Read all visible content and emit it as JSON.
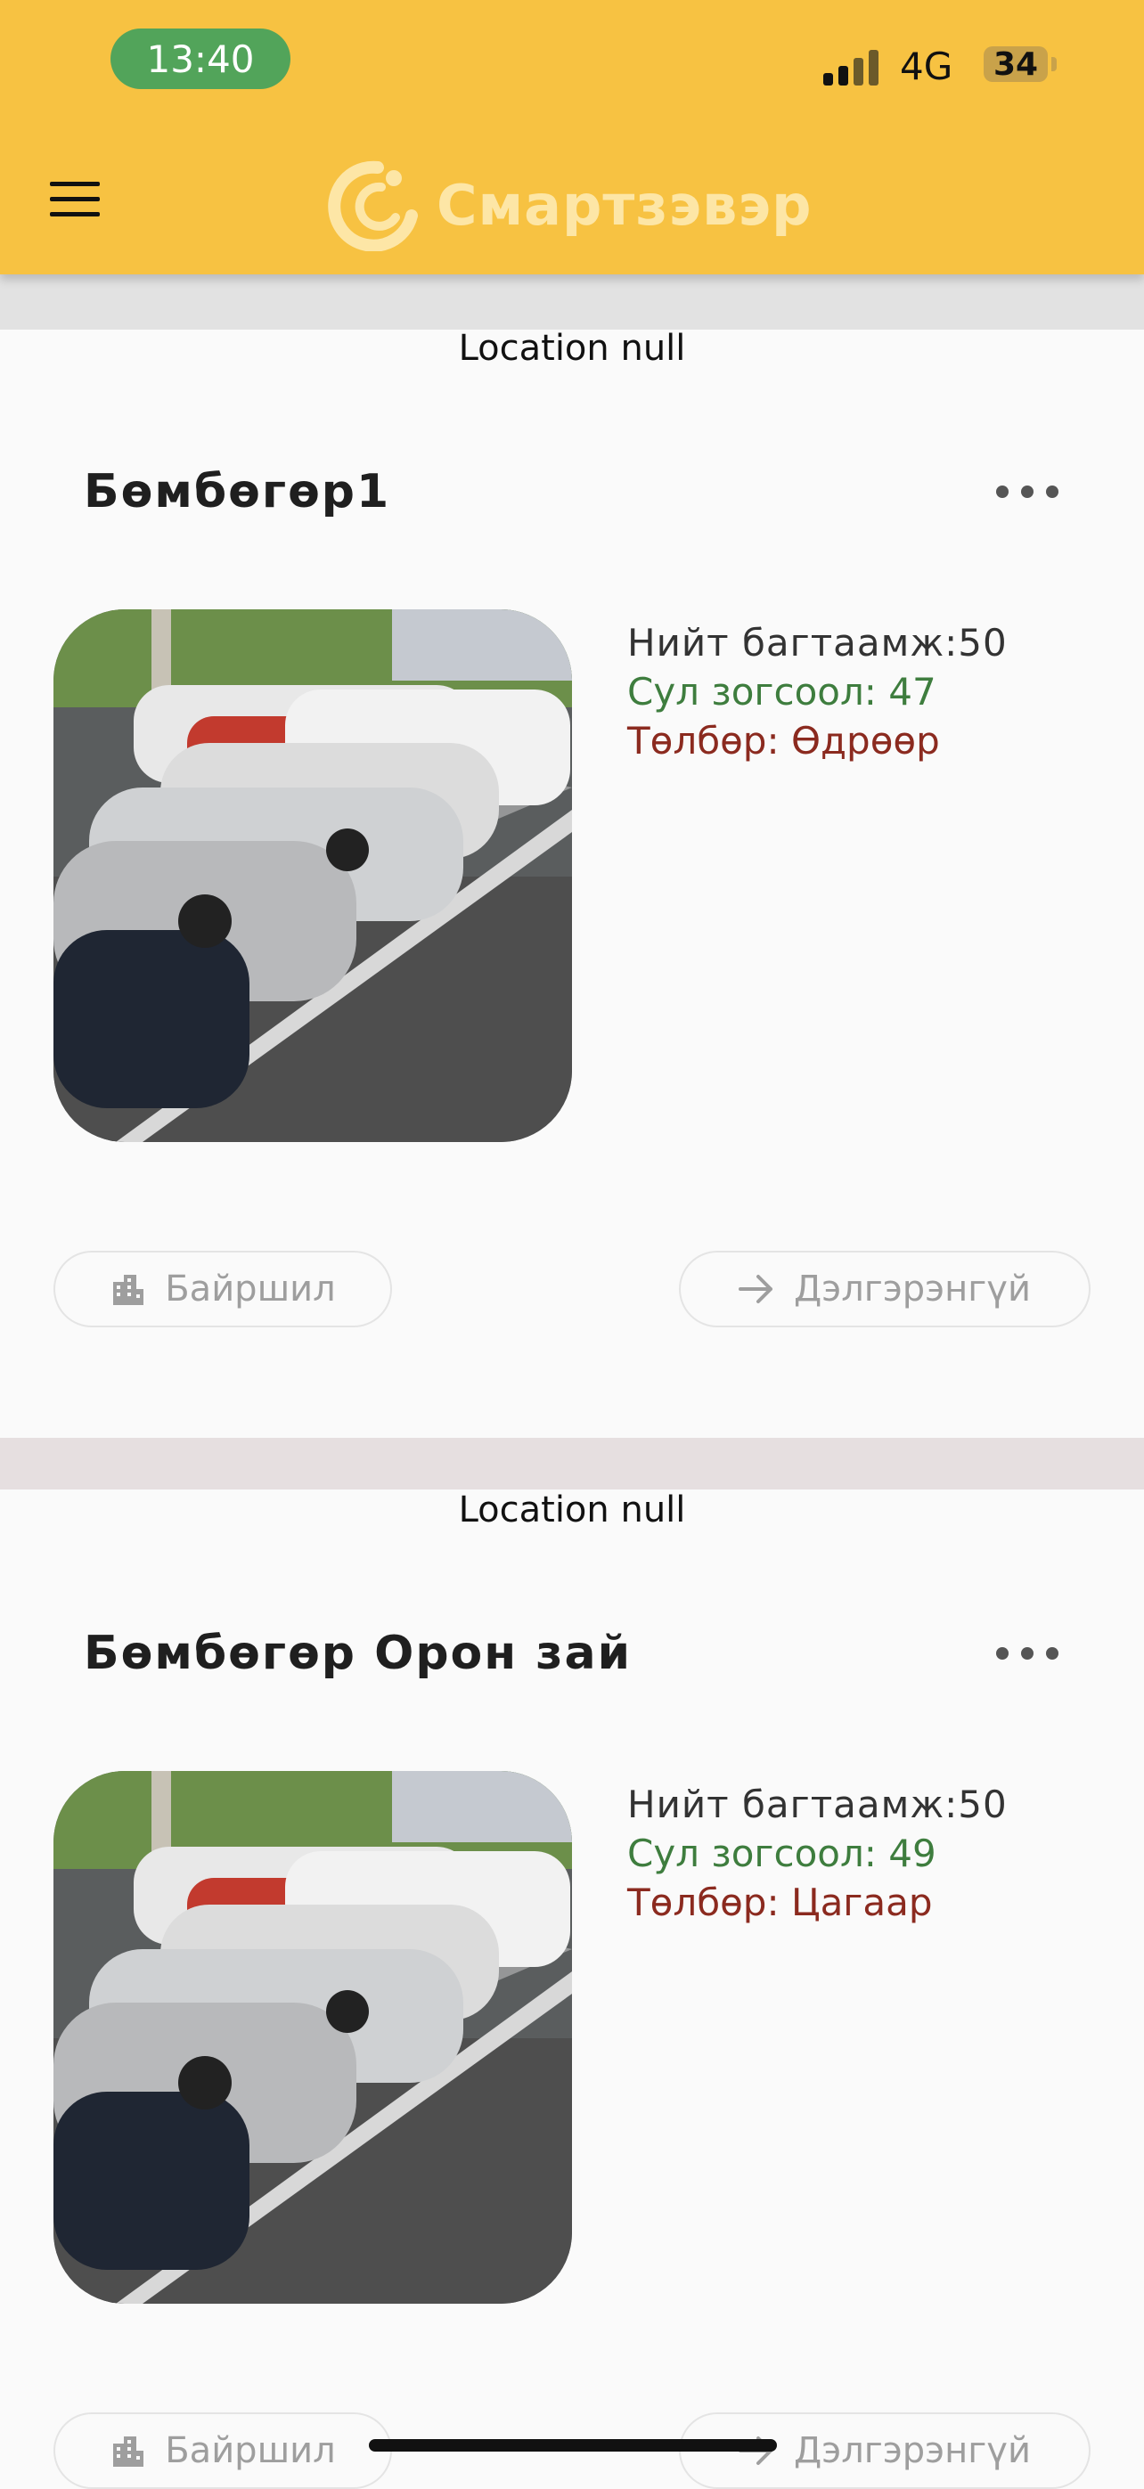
{
  "status_bar": {
    "time": "13:40",
    "network": "4G",
    "battery": "34"
  },
  "header": {
    "logo_text": "Смартзэвэр",
    "menu_icon": "hamburger-menu-icon",
    "color": "#f7c242"
  },
  "cards": [
    {
      "location": "Location null",
      "title": "Бөмбөгөр1",
      "capacity": "Нийт багтаамж:50",
      "free": "Сул зогсоол: 47",
      "payment": "Төлбөр: Өдрөөр",
      "location_button": "Байршил",
      "details_button": "Дэлгэрэнгүй"
    },
    {
      "location": "Location null",
      "title": "Бөмбөгөр Орон зай",
      "capacity": "Нийт багтаамж:50",
      "free": "Сул зогсоол: 49",
      "payment": "Төлбөр: Цагаар",
      "location_button": "Байршил",
      "details_button": "Дэлгэрэнгүй"
    }
  ],
  "colors": {
    "free": "#3e7d3e",
    "payment": "#8b2a1f",
    "accent": "#f7c242"
  }
}
